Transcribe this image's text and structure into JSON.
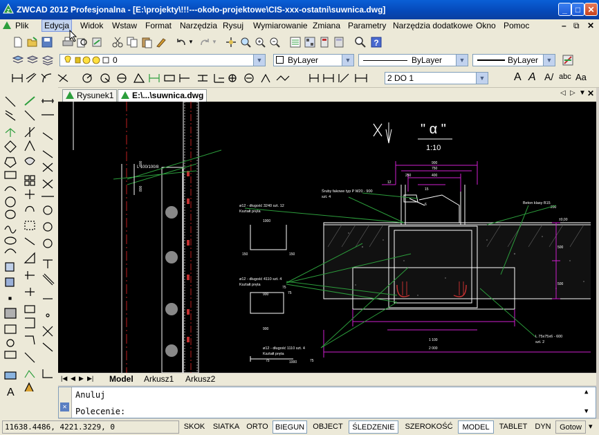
{
  "window": {
    "title": "ZWCAD 2012 Profesjonalna - [E:\\projekty\\!!!---około-projektowe\\CIS-xxx-ostatni\\suwnica.dwg]"
  },
  "menu": [
    "Plik",
    "Edycja",
    "Widok",
    "Wstaw",
    "Format",
    "Narzędzia",
    "Rysuj",
    "Wymiarowanie",
    "Zmiana",
    "Parametry",
    "Narzędzia dodatkowe",
    "Okno",
    "Pomoc"
  ],
  "layer_toolbar": {
    "layer_value": "0",
    "color": "ByLayer",
    "linetype": "ByLayer",
    "lineweight": "ByLayer"
  },
  "dim_toolbar": {
    "dimstyle": "2 DO 1"
  },
  "doc_tabs": [
    "Rysunek1",
    "E:\\...\\suwnica.dwg"
  ],
  "layout_tabs": [
    "Model",
    "Arkusz1",
    "Arkusz2"
  ],
  "command": {
    "history": "Anuluj",
    "prompt": "Polecenie:"
  },
  "status": {
    "coords": "11638.4486, 4221.3229, 0",
    "buttons": [
      "SKOK",
      "SIATKA",
      "ORTO",
      "BIEGUN",
      "OBJECT",
      "ŚLEDZENIE",
      "SZEROKOŚĆ",
      "MODEL",
      "TABLET",
      "DYN",
      "Gotow"
    ],
    "active": [
      "BIEGUN",
      "ŚLEDZENIE",
      "MODEL"
    ]
  },
  "drawing": {
    "title_mark": "\" α \"",
    "scale": "1:10",
    "labels": {
      "l_100": "L 100/100/8",
      "sruby": "Śruby fakowe typ P M20 - 900",
      "szt4a": "szt. 4",
      "beton": "Beton klasy B15",
      "pr12a": "ø12 - długość 3240  szt. 12",
      "kszt": "Kształt pręta",
      "pr12b": "ø12 - długość 4110  szt. 4",
      "pr12c": "ø12 - długość 1110  szt. 4",
      "l_75": "L 75x75x6 - 600",
      "szt2": "szt. 2",
      "v_mark": "\" v \"",
      "d_1000": "1000",
      "d_150a": "150",
      "d_150b": "150",
      "d_600": "600",
      "d_800": "800",
      "d_75a": "75",
      "d_75b": "75",
      "d_75c": "75",
      "d_1000b": "1000",
      "d_75d": "75",
      "d_900a": "900",
      "d_900b": "900",
      "d_1100": "1 100",
      "d_2000": "2 000",
      "d_900t": "900",
      "d_750": "750",
      "d_400": "400",
      "d_250": "250",
      "d_12": "12",
      "d_200": "200",
      "d_810": "810",
      "d_500a": "500",
      "d_500b": "500",
      "d_h100": "±0,00",
      "d_15": "15",
      "d_6": "6"
    }
  }
}
